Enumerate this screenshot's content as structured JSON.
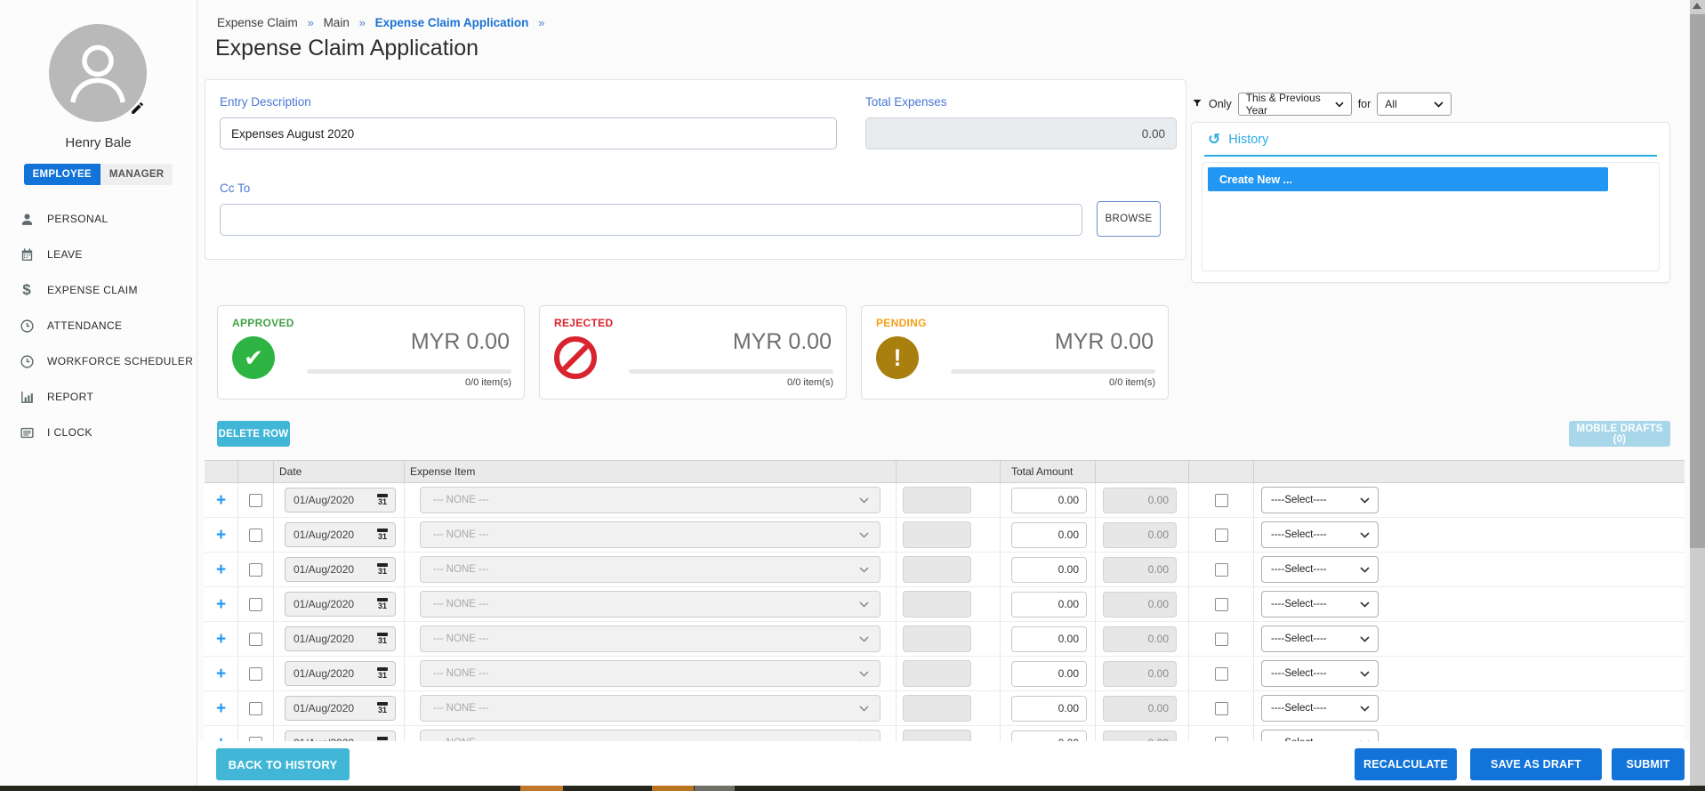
{
  "sidebar": {
    "user_name": "Henry Bale",
    "role_tabs": [
      {
        "label": "EMPLOYEE",
        "active": true
      },
      {
        "label": "MANAGER",
        "active": false
      }
    ],
    "items": [
      {
        "label": "PERSONAL",
        "icon": "person-icon"
      },
      {
        "label": "LEAVE",
        "icon": "calendar-icon"
      },
      {
        "label": "EXPENSE CLAIM",
        "icon": "dollar-icon"
      },
      {
        "label": "ATTENDANCE",
        "icon": "clock-icon"
      },
      {
        "label": "WORKFORCE SCHEDULER",
        "icon": "clock-icon"
      },
      {
        "label": "REPORT",
        "icon": "bar-chart-icon"
      },
      {
        "label": "I CLOCK",
        "icon": "card-list-icon"
      }
    ]
  },
  "breadcrumb": {
    "items": [
      "Expense Claim",
      "Main",
      "Expense Claim Application"
    ]
  },
  "page_title": "Expense Claim Application",
  "form": {
    "entry_description": {
      "label": "Entry Description",
      "value": "Expenses August 2020"
    },
    "total_expenses": {
      "label": "Total Expenses",
      "value": "0.00"
    },
    "cc_to": {
      "label": "Cc To",
      "value": "",
      "browse_label": "BROWSE"
    }
  },
  "filter": {
    "only_label": "Only",
    "period_value": "This & Previous Year",
    "for_label": "for",
    "scope_value": "All"
  },
  "history": {
    "title": "History",
    "items": [
      {
        "label": "Create New ...",
        "selected": true
      }
    ]
  },
  "summary_cards": [
    {
      "label": "APPROVED",
      "amount": "MYR 0.00",
      "items": "0/0 item(s)",
      "color": "#2eb442",
      "icon": "check-circle-icon"
    },
    {
      "label": "REJECTED",
      "amount": "MYR 0.00",
      "items": "0/0 item(s)",
      "color": "#d9232e",
      "icon": "no-entry-icon"
    },
    {
      "label": "PENDING",
      "amount": "MYR 0.00",
      "items": "0/0 item(s)",
      "color": "#a97f10",
      "icon": "exclamation-circle-icon"
    }
  ],
  "table": {
    "delete_row_label": "DELETE ROW",
    "mobile_drafts_label": "MOBILE DRAFTS (0)",
    "columns": {
      "date": "Date",
      "expense_item": "Expense Item",
      "total_amount": "Total Amount"
    },
    "row": {
      "date": "01/Aug/2020",
      "calendar_day": "31",
      "expense_item": "--- NONE ---",
      "amount": "0.00",
      "readonly_amount": "0.00",
      "select": "----Select----"
    },
    "row_count": 8
  },
  "footer": {
    "back_label": "BACK TO HISTORY",
    "recalculate_label": "RECALCULATE",
    "save_draft_label": "SAVE AS DRAFT",
    "submit_label": "SUBMIT"
  },
  "colors": {
    "primary_blue": "#1273d8",
    "cyan_button": "#41b6d6",
    "cyan_disabled": "#a9d7ea",
    "label_blue": "#4a77d4",
    "breadcrumb_active": "#1a73d4",
    "history_accent": "#29abe2",
    "create_new_bg": "#2196f3",
    "approved_green": "#2eb442",
    "rejected_red": "#d9232e",
    "pending_gold": "#a97f10",
    "add_row_blue": "#2196f3",
    "table_header_bg": "#eaeaea"
  }
}
